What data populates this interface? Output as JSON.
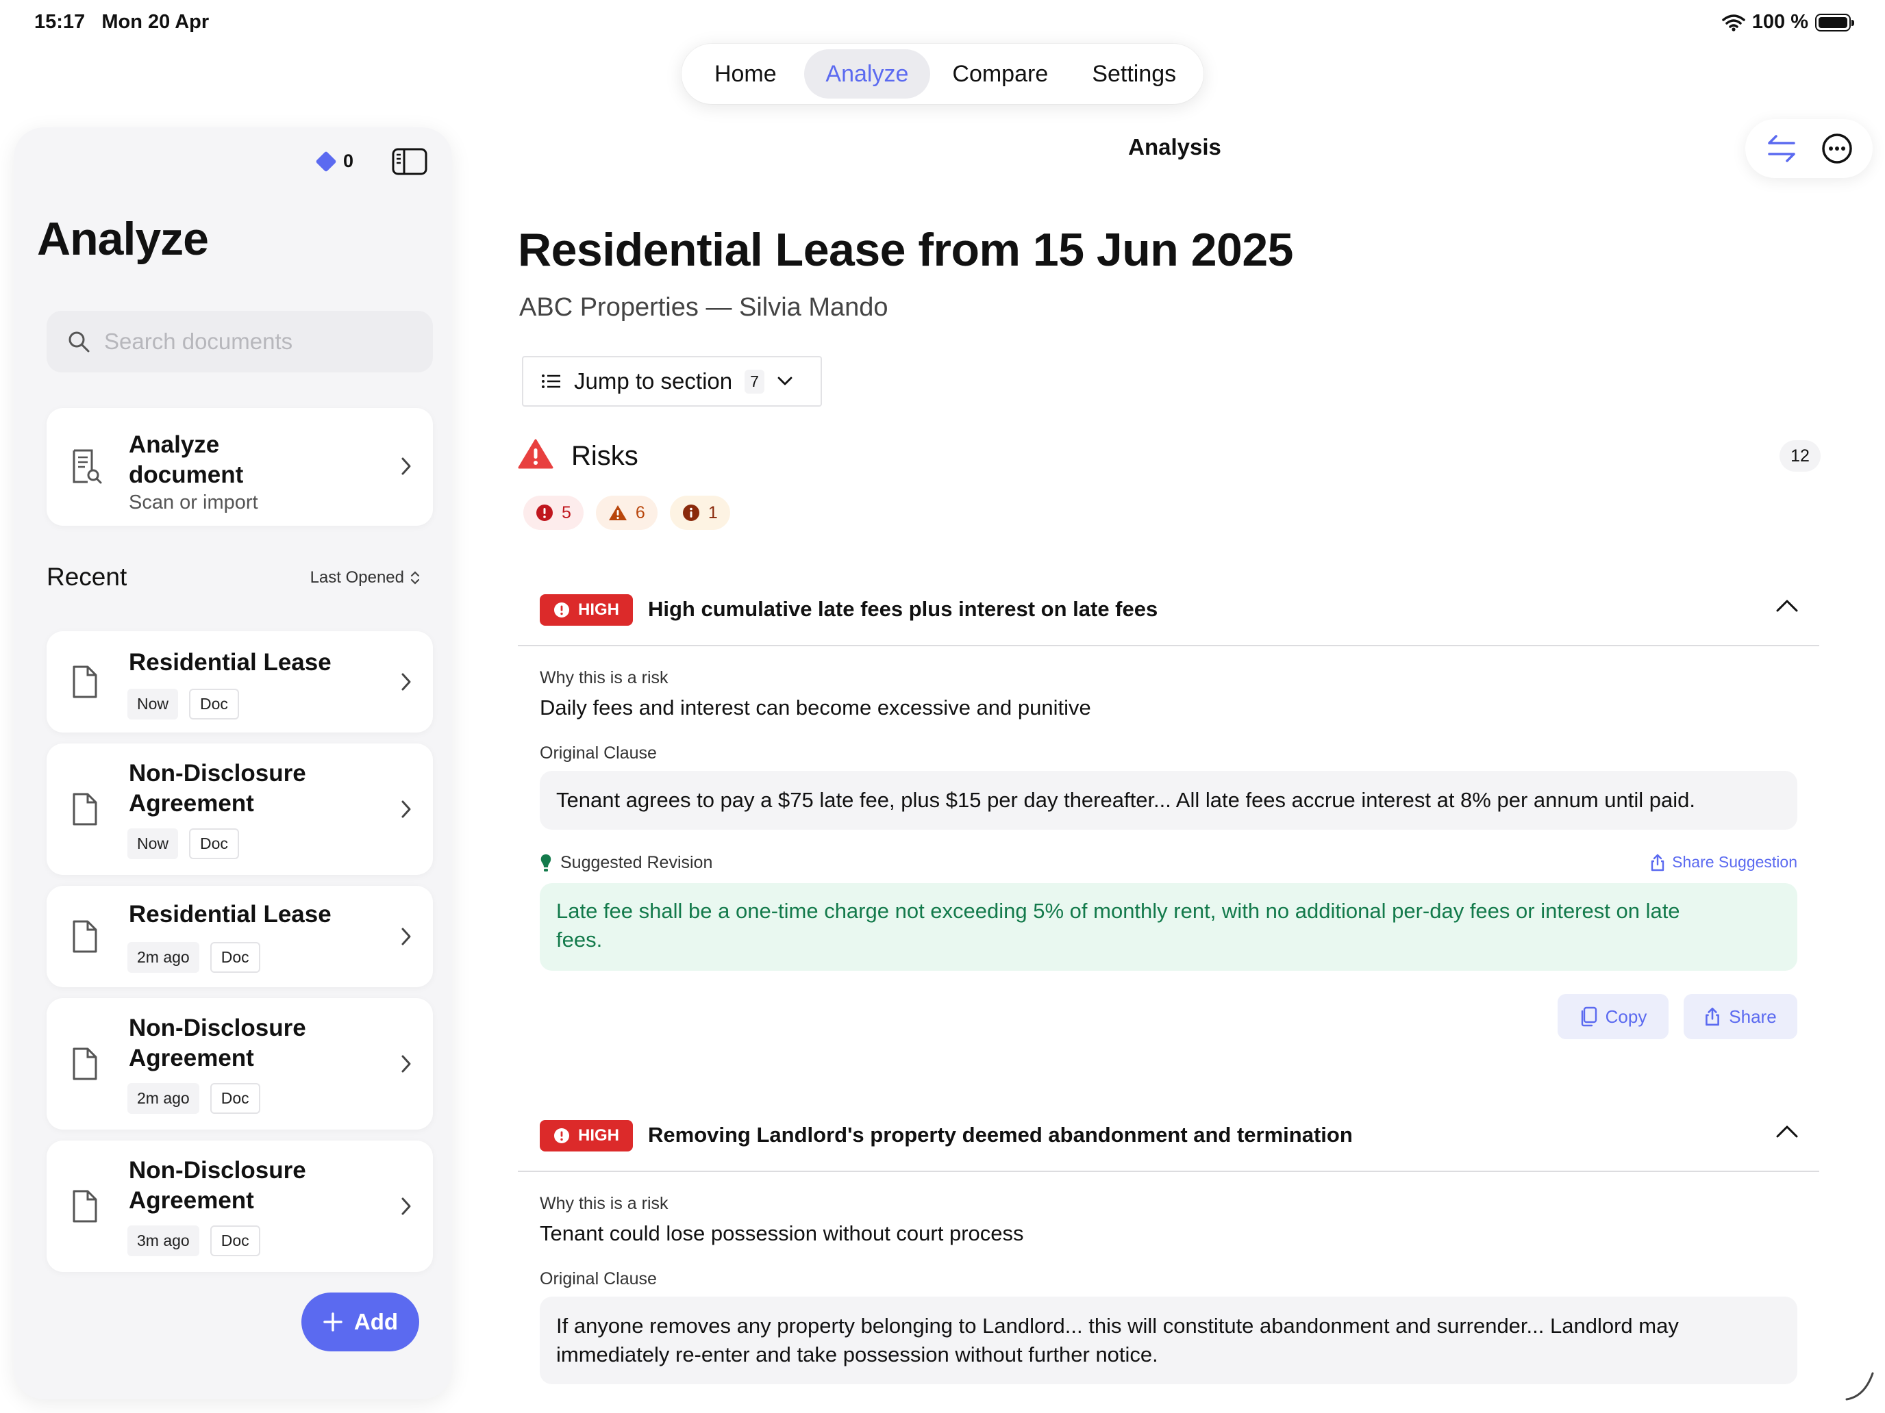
{
  "status": {
    "time": "15:17",
    "date": "Mon 20 Apr",
    "battery": "100 %"
  },
  "tabs": [
    {
      "label": "Home",
      "active": false
    },
    {
      "label": "Analyze",
      "active": true
    },
    {
      "label": "Compare",
      "active": false
    },
    {
      "label": "Settings",
      "active": false
    }
  ],
  "sidebar": {
    "gem_count": "0",
    "title": "Analyze",
    "search": {
      "placeholder": "Search documents",
      "value": ""
    },
    "analyze_card": {
      "title": "Analyze document",
      "subtitle": "Scan or import"
    },
    "recent_label": "Recent",
    "sort_label": "Last Opened",
    "recent": [
      {
        "title": "Residential Lease",
        "time": "Now",
        "type": "Doc"
      },
      {
        "title": "Non-Disclosure Agreement",
        "time": "Now",
        "type": "Doc"
      },
      {
        "title": "Residential Lease",
        "time": "2m ago",
        "type": "Doc"
      },
      {
        "title": "Non-Disclosure Agreement",
        "time": "2m ago",
        "type": "Doc"
      },
      {
        "title": "Non-Disclosure Agreement",
        "time": "3m ago",
        "type": "Doc"
      }
    ],
    "add_label": "Add"
  },
  "main": {
    "nav_title": "Analysis",
    "doc_title": "Residential Lease from 15 Jun 2025",
    "doc_subtitle": "ABC Properties — Silvia Mando",
    "jump_label": "Jump to section",
    "jump_count": "7",
    "risks_label": "Risks",
    "risks_total": "12",
    "severity_counts": {
      "high": "5",
      "medium": "6",
      "low": "1"
    },
    "risks": [
      {
        "severity": "HIGH",
        "title": "High cumulative late fees plus interest on late fees",
        "why_label": "Why this is a risk",
        "why": "Daily fees and interest can become excessive and punitive",
        "clause_label": "Original Clause",
        "clause": "Tenant agrees to pay a $75 late fee, plus $15 per day thereafter... All late fees accrue interest at 8% per annum until paid.",
        "suggestion_label": "Suggested Revision",
        "share_suggestion": "Share Suggestion",
        "suggestion": "Late fee shall be a one-time charge not exceeding 5% of monthly rent, with no additional per-day fees or interest on late fees.",
        "copy_label": "Copy",
        "share_label": "Share"
      },
      {
        "severity": "HIGH",
        "title": "Removing Landlord's property deemed abandonment and termination",
        "why_label": "Why this is a risk",
        "why": "Tenant could lose possession without court process",
        "clause_label": "Original Clause",
        "clause": "If anyone removes any property belonging to Landlord... this will constitute abandonment and surrender... Landlord may immediately re-enter and take possession without further notice."
      }
    ]
  },
  "colors": {
    "accent": "#5b6af0",
    "high": "#dc2a2a",
    "medium": "#b8460c",
    "revision_bg": "#e9f8f0",
    "revision_text": "#137a4b"
  }
}
